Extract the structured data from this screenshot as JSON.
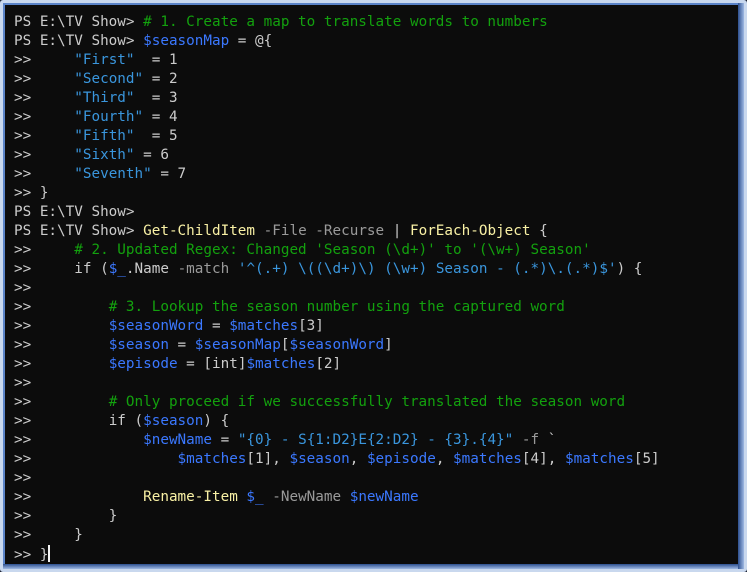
{
  "terminal": {
    "colors": {
      "background": "#0c0c0c",
      "prompt": "#cccccc",
      "comment": "#13a10e",
      "variable": "#3b78ff",
      "string": "#3a96dd",
      "command": "#f9f1a5",
      "parameter": "#9a9a9a",
      "default": "#cccccc"
    },
    "lines": [
      [
        {
          "t": "PS E:\\TV Show> ",
          "c": "prompt"
        },
        {
          "t": "# 1. Create a map to translate words to numbers",
          "c": "comment"
        }
      ],
      [
        {
          "t": "PS E:\\TV Show> ",
          "c": "prompt"
        },
        {
          "t": "$seasonMap",
          "c": "variable"
        },
        {
          "t": " = @{",
          "c": "default"
        }
      ],
      [
        {
          "t": ">>     ",
          "c": "cont"
        },
        {
          "t": "\"First\"",
          "c": "string"
        },
        {
          "t": "  = 1",
          "c": "default"
        }
      ],
      [
        {
          "t": ">>     ",
          "c": "cont"
        },
        {
          "t": "\"Second\"",
          "c": "string"
        },
        {
          "t": " = 2",
          "c": "default"
        }
      ],
      [
        {
          "t": ">>     ",
          "c": "cont"
        },
        {
          "t": "\"Third\"",
          "c": "string"
        },
        {
          "t": "  = 3",
          "c": "default"
        }
      ],
      [
        {
          "t": ">>     ",
          "c": "cont"
        },
        {
          "t": "\"Fourth\"",
          "c": "string"
        },
        {
          "t": " = 4",
          "c": "default"
        }
      ],
      [
        {
          "t": ">>     ",
          "c": "cont"
        },
        {
          "t": "\"Fifth\"",
          "c": "string"
        },
        {
          "t": "  = 5",
          "c": "default"
        }
      ],
      [
        {
          "t": ">>     ",
          "c": "cont"
        },
        {
          "t": "\"Sixth\"",
          "c": "string"
        },
        {
          "t": " = 6",
          "c": "default"
        }
      ],
      [
        {
          "t": ">>     ",
          "c": "cont"
        },
        {
          "t": "\"Seventh\"",
          "c": "string"
        },
        {
          "t": " = 7",
          "c": "default"
        }
      ],
      [
        {
          "t": ">> ",
          "c": "cont"
        },
        {
          "t": "}",
          "c": "default"
        }
      ],
      [
        {
          "t": "PS E:\\TV Show>",
          "c": "prompt"
        }
      ],
      [
        {
          "t": "PS E:\\TV Show> ",
          "c": "prompt"
        },
        {
          "t": "Get-ChildItem",
          "c": "command"
        },
        {
          "t": " -File -Recurse",
          "c": "param"
        },
        {
          "t": " | ",
          "c": "default"
        },
        {
          "t": "ForEach-Object",
          "c": "command"
        },
        {
          "t": " {",
          "c": "default"
        }
      ],
      [
        {
          "t": ">>     ",
          "c": "cont"
        },
        {
          "t": "# 2. Updated Regex: Changed 'Season (\\d+)' to '(\\w+) Season'",
          "c": "comment"
        }
      ],
      [
        {
          "t": ">>     ",
          "c": "cont"
        },
        {
          "t": "if (",
          "c": "default"
        },
        {
          "t": "$_",
          "c": "variable"
        },
        {
          "t": ".Name ",
          "c": "default"
        },
        {
          "t": "-match",
          "c": "param"
        },
        {
          "t": " ",
          "c": "default"
        },
        {
          "t": "'^(.+) \\((\\d+)\\) (\\w+) Season - (.*)\\.(.*)$'",
          "c": "string"
        },
        {
          "t": ") {",
          "c": "default"
        }
      ],
      [
        {
          "t": ">>",
          "c": "cont"
        }
      ],
      [
        {
          "t": ">>         ",
          "c": "cont"
        },
        {
          "t": "# 3. Lookup the season number using the captured word",
          "c": "comment"
        }
      ],
      [
        {
          "t": ">>         ",
          "c": "cont"
        },
        {
          "t": "$seasonWord",
          "c": "variable"
        },
        {
          "t": " = ",
          "c": "default"
        },
        {
          "t": "$matches",
          "c": "variable"
        },
        {
          "t": "[3]",
          "c": "default"
        }
      ],
      [
        {
          "t": ">>         ",
          "c": "cont"
        },
        {
          "t": "$season",
          "c": "variable"
        },
        {
          "t": " = ",
          "c": "default"
        },
        {
          "t": "$seasonMap",
          "c": "variable"
        },
        {
          "t": "[",
          "c": "default"
        },
        {
          "t": "$seasonWord",
          "c": "variable"
        },
        {
          "t": "]",
          "c": "default"
        }
      ],
      [
        {
          "t": ">>         ",
          "c": "cont"
        },
        {
          "t": "$episode",
          "c": "variable"
        },
        {
          "t": " = [int]",
          "c": "default"
        },
        {
          "t": "$matches",
          "c": "variable"
        },
        {
          "t": "[2]",
          "c": "default"
        }
      ],
      [
        {
          "t": ">>",
          "c": "cont"
        }
      ],
      [
        {
          "t": ">>         ",
          "c": "cont"
        },
        {
          "t": "# Only proceed if we successfully translated the season word",
          "c": "comment"
        }
      ],
      [
        {
          "t": ">>         ",
          "c": "cont"
        },
        {
          "t": "if (",
          "c": "default"
        },
        {
          "t": "$season",
          "c": "variable"
        },
        {
          "t": ") {",
          "c": "default"
        }
      ],
      [
        {
          "t": ">>             ",
          "c": "cont"
        },
        {
          "t": "$newName",
          "c": "variable"
        },
        {
          "t": " = ",
          "c": "default"
        },
        {
          "t": "\"{0} - S{1:D2}E{2:D2} - {3}.{4}\"",
          "c": "string"
        },
        {
          "t": " -f",
          "c": "param"
        },
        {
          "t": " `",
          "c": "default"
        }
      ],
      [
        {
          "t": ">>                 ",
          "c": "cont"
        },
        {
          "t": "$matches",
          "c": "variable"
        },
        {
          "t": "[1], ",
          "c": "default"
        },
        {
          "t": "$season",
          "c": "variable"
        },
        {
          "t": ", ",
          "c": "default"
        },
        {
          "t": "$episode",
          "c": "variable"
        },
        {
          "t": ", ",
          "c": "default"
        },
        {
          "t": "$matches",
          "c": "variable"
        },
        {
          "t": "[4], ",
          "c": "default"
        },
        {
          "t": "$matches",
          "c": "variable"
        },
        {
          "t": "[5]",
          "c": "default"
        }
      ],
      [
        {
          "t": ">>",
          "c": "cont"
        }
      ],
      [
        {
          "t": ">>             ",
          "c": "cont"
        },
        {
          "t": "Rename-Item",
          "c": "command"
        },
        {
          "t": " ",
          "c": "default"
        },
        {
          "t": "$_",
          "c": "variable"
        },
        {
          "t": " -NewName",
          "c": "param"
        },
        {
          "t": " ",
          "c": "default"
        },
        {
          "t": "$newName",
          "c": "variable"
        }
      ],
      [
        {
          "t": ">>         ",
          "c": "cont"
        },
        {
          "t": "}",
          "c": "default"
        }
      ],
      [
        {
          "t": ">>     ",
          "c": "cont"
        },
        {
          "t": "}",
          "c": "default"
        }
      ],
      [
        {
          "t": ">> ",
          "c": "cont"
        },
        {
          "t": "}",
          "c": "default"
        }
      ]
    ]
  }
}
